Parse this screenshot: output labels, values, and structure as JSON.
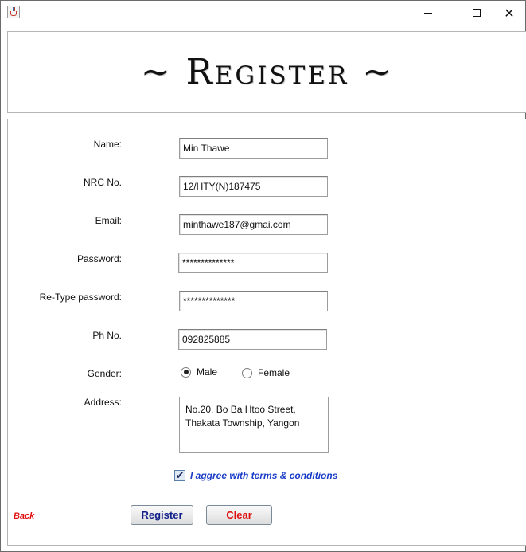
{
  "window": {
    "app_icon": "java-cup-icon",
    "minimize_icon": "minimize-icon",
    "maximize_icon": "maximize-icon",
    "close_icon": "close-icon",
    "close_glyph": "✕"
  },
  "header": {
    "title": "~ Register ~"
  },
  "form": {
    "name_label": "Name:",
    "name_value": "Min Thawe",
    "nrc_label": "NRC No.",
    "nrc_value": "12/HTY(N)187475",
    "email_label": "Email:",
    "email_value": "minthawe187@gmai.com",
    "password_label": "Password:",
    "password_value": "**************",
    "retype_label": "Re-Type password:",
    "retype_value": "**************",
    "phone_label": "Ph No.",
    "phone_value": "092825885",
    "gender_label": "Gender:",
    "gender_options": [
      "Male",
      "Female"
    ],
    "gender_selected": "Male",
    "address_label": "Address:",
    "address_value": "No.20, Bo Ba Htoo Street,\nThakata Township, Yangon",
    "agree_text": "I aggree with terms & conditions",
    "agree_checked": true,
    "agree_glyph": "✔"
  },
  "actions": {
    "back_label": "Back",
    "register_label": "Register",
    "clear_label": "Clear"
  },
  "colors": {
    "agree_text": "#1a3cc8",
    "back_text": "#e01010",
    "register_text": "#13208a",
    "clear_text": "#e01010"
  }
}
